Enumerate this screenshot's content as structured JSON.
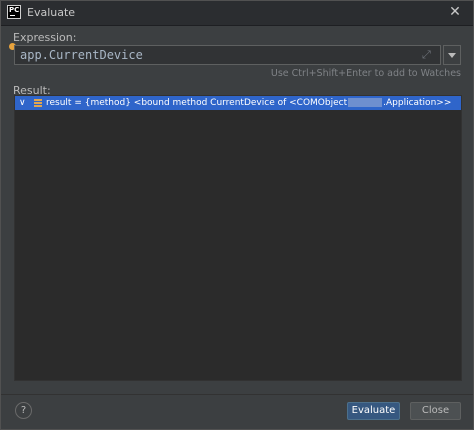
{
  "window": {
    "title": "Evaluate",
    "app_icon_text": "PC"
  },
  "expression": {
    "label": "Expression:",
    "value": "app.CurrentDevice",
    "hint": "Use Ctrl+Shift+Enter to add to Watches"
  },
  "result": {
    "label": "Result:",
    "rows": [
      {
        "prefix": "result = {method} <bound method CurrentDevice of <COMObject",
        "suffix": ".Application>>"
      }
    ]
  },
  "footer": {
    "help_label": "?",
    "evaluate_label": "Evaluate",
    "close_label": "Close"
  },
  "icons": {
    "close": "close-icon",
    "expand": "expand-icon",
    "history": "chevron-down-icon",
    "row_toggle": "chevron-down-icon",
    "row_type": "list-icon"
  },
  "colors": {
    "accent": "#2f65ca",
    "primary_button": "#365880",
    "marker": "#e8a33d"
  }
}
